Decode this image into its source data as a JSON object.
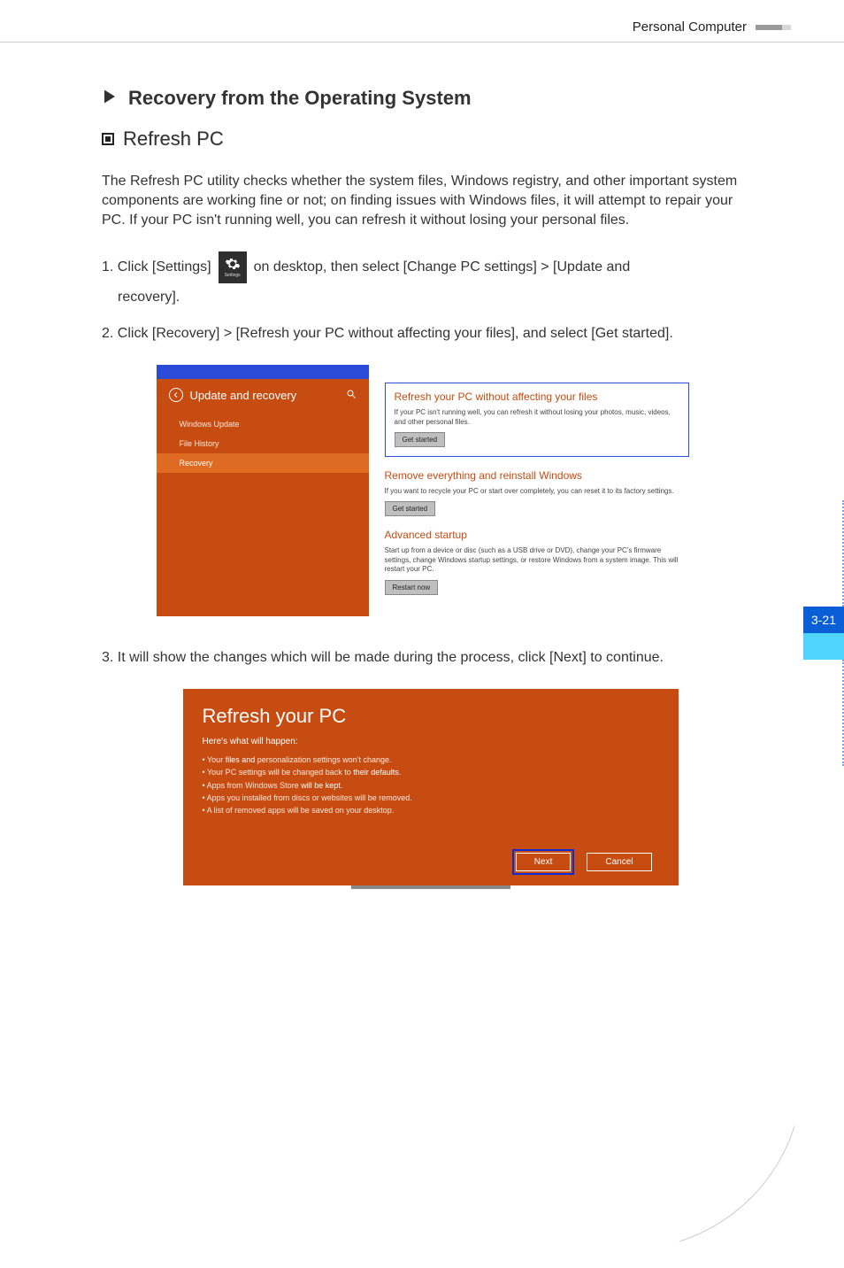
{
  "header": {
    "title": "Personal Computer"
  },
  "section": {
    "title": "Recovery from the Operating System",
    "subsection_title": "Refresh PC",
    "intro": "The Refresh PC utility checks whether the system files, Windows registry, and other important system components are working fine or not; on finding issues with Windows files, it will attempt to repair your PC.  If your PC isn't running well, you can refresh it without losing your personal files.",
    "step1a": "1. Click [Settings]",
    "step1b": "on desktop, then select [Change PC settings] > [Update and",
    "step1c": "recovery].",
    "charm_label": "Settings",
    "step2": "2. Click [Recovery] > [Refresh your PC without affecting your files], and select [Get started].",
    "step3": "3. It will show the changes which will be made during the process, click [Next] to continue."
  },
  "shot1": {
    "left_title": "Update and recovery",
    "nav": [
      "Windows Update",
      "File History",
      "Recovery"
    ],
    "active_nav_index": 2,
    "refresh": {
      "heading": "Refresh your PC without affecting your files",
      "body": "If your PC isn't running well, you can refresh it without losing your photos, music, videos, and other personal files.",
      "button": "Get started"
    },
    "remove": {
      "heading": "Remove everything and reinstall Windows",
      "body": "If you want to recycle your PC or start over completely, you can reset it to its factory settings.",
      "button": "Get started"
    },
    "advanced": {
      "heading": "Advanced startup",
      "body": "Start up from a device or disc (such as a USB drive or DVD), change your PC's firmware settings, change Windows startup settings, or restore Windows from a system image. This will restart your PC.",
      "button": "Restart now"
    }
  },
  "shot2": {
    "title": "Refresh your PC",
    "subtitle": "Here's what will happen:",
    "items": [
      {
        "pre": "Your ",
        "em": "files and",
        "post": " personalization settings won't change."
      },
      {
        "pre": "Your PC settings will be changed back to ",
        "em": "their defaults.",
        "post": ""
      },
      {
        "pre": "Apps from Windows Store ",
        "em": "will be kept.",
        "post": ""
      },
      {
        "pre": "Apps you installed from discs or websites will be removed.",
        "em": "",
        "post": ""
      },
      {
        "pre": "A list of removed apps will be saved on your desktop.",
        "em": "",
        "post": ""
      }
    ],
    "next": "Next",
    "cancel": "Cancel"
  },
  "side": {
    "page_tab": "3-21"
  }
}
